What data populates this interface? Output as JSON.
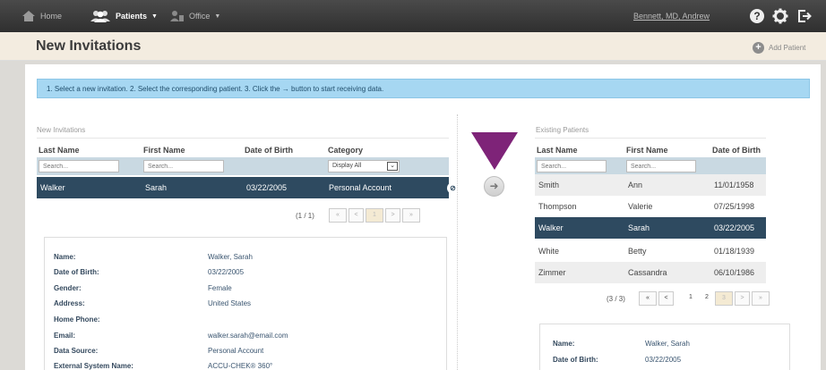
{
  "topnav": {
    "home": "Home",
    "patients": "Patients",
    "office": "Office",
    "user": "Bennett, MD, Andrew"
  },
  "header": {
    "title": "New Invitations",
    "add_patient": "Add Patient"
  },
  "instructions": "1. Select a new invitation. 2. Select the corresponding patient. 3. Click the → button to start receiving data.",
  "invitations": {
    "section_title": "New Invitations",
    "columns": [
      "Last Name",
      "First Name",
      "Date of Birth",
      "Category"
    ],
    "search_placeholder_last": "Search...",
    "search_placeholder_first": "Search...",
    "category_filter": "Display All",
    "rows": [
      {
        "last": "Walker",
        "first": "Sarah",
        "dob": "03/22/2005",
        "category": "Personal Account"
      }
    ],
    "pager": {
      "count": "(1 / 1)",
      "first": "«",
      "prev": "<",
      "page": "1",
      "next": ">",
      "last": "»"
    }
  },
  "existing": {
    "section_title": "Existing Patients",
    "columns": [
      "Last Name",
      "First Name",
      "Date of Birth"
    ],
    "search_placeholder_last": "Search...",
    "search_placeholder_first": "Search...",
    "rows": [
      {
        "last": "Smith",
        "first": "Ann",
        "dob": "11/01/1958"
      },
      {
        "last": "Thompson",
        "first": "Valerie",
        "dob": "07/25/1998"
      },
      {
        "last": "Walker",
        "first": "Sarah",
        "dob": "03/22/2005"
      },
      {
        "last": "White",
        "first": "Betty",
        "dob": "01/18/1939"
      },
      {
        "last": "Zimmer",
        "first": "Cassandra",
        "dob": "06/10/1986"
      }
    ],
    "pager": {
      "count": "(3 / 3)",
      "first": "«",
      "prev": "<",
      "p1": "1",
      "p2": "2",
      "p3": "3",
      "next": ">",
      "last": "»"
    }
  },
  "invitation_details": {
    "name_label": "Name:",
    "name": "Walker, Sarah",
    "dob_label": "Date of Birth:",
    "dob": "03/22/2005",
    "gender_label": "Gender:",
    "gender": "Female",
    "address_label": "Address:",
    "address": "United States",
    "phone_label": "Home Phone:",
    "phone": "",
    "email_label": "Email:",
    "email": "walker.sarah@email.com",
    "source_label": "Data Source:",
    "source": "Personal Account",
    "external_label": "External System Name:",
    "external": "ACCU-CHEK® 360°"
  },
  "patient_details": {
    "name_label": "Name:",
    "name": "Walker, Sarah",
    "dob_label": "Date of Birth:",
    "dob": "03/22/2005"
  },
  "colors": {
    "selected_row": "#2e4a60",
    "info_bar": "#a6d7f2",
    "pointer": "#7e2378"
  }
}
